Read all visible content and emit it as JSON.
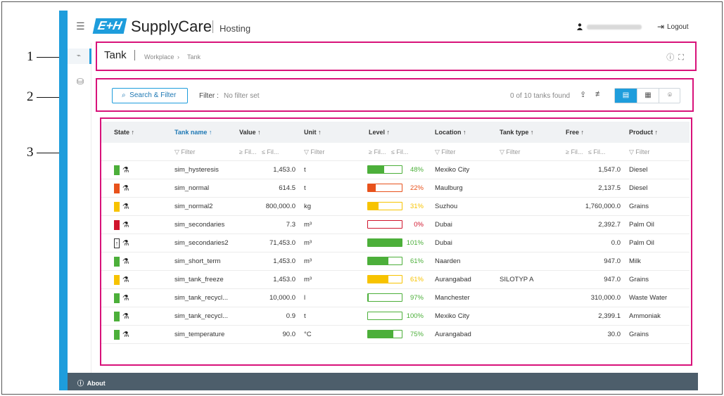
{
  "callouts": [
    "1",
    "2",
    "3"
  ],
  "app": {
    "brand_logo": "E+H",
    "brand_name": "SupplyCare",
    "brand_sub": "Hosting",
    "logout_label": "Logout",
    "about_label": "About"
  },
  "header": {
    "title": "Tank",
    "breadcrumb": [
      "Workplace",
      "Tank"
    ]
  },
  "toolbar": {
    "search_label": "Search & Filter",
    "filter_label": "Filter :",
    "filter_value": "No filter set",
    "tanks_found": "0 of 10 tanks found"
  },
  "table": {
    "columns": [
      "State",
      "Tank name",
      "Value",
      "Unit",
      "Level",
      "Location",
      "Tank type",
      "Free",
      "Product"
    ],
    "sorted_column": "Tank name",
    "filter_placeholder": "Filter",
    "range_min": "≥ Fil...",
    "range_max": "≤ Fil...",
    "rows": [
      {
        "state_color": "#4caf3a",
        "name": "sim_hysteresis",
        "value": "1,453.0",
        "unit": "t",
        "level": 48,
        "level_label": "48%",
        "level_color": "#4caf3a",
        "location": "Mexiko City",
        "tank_type": "",
        "free": "1,547.0",
        "product": "Diesel"
      },
      {
        "state_color": "#e8521c",
        "name": "sim_normal",
        "value": "614.5",
        "unit": "t",
        "level": 22,
        "level_label": "22%",
        "level_color": "#e8521c",
        "location": "Maulburg",
        "tank_type": "",
        "free": "2,137.5",
        "product": "Diesel"
      },
      {
        "state_color": "#f7c300",
        "name": "sim_normal2",
        "value": "800,000.0",
        "unit": "kg",
        "level": 31,
        "level_label": "31%",
        "level_color": "#f7c300",
        "location": "Suzhou",
        "tank_type": "",
        "free": "1,760,000.0",
        "product": "Grains"
      },
      {
        "state_color": "#d0142c",
        "name": "sim_secondaries",
        "value": "7.3",
        "unit": "m³",
        "level": 0,
        "level_label": "0%",
        "level_color": "#d0142c",
        "location": "Dubai",
        "tank_type": "",
        "free": "2,392.7",
        "product": "Palm Oil"
      },
      {
        "state_color": "",
        "name": "sim_secondaries2",
        "value": "71,453.0",
        "unit": "m³",
        "level": 101,
        "level_label": "101%",
        "level_color": "#4caf3a",
        "location": "Dubai",
        "tank_type": "",
        "free": "0.0",
        "product": "Palm Oil"
      },
      {
        "state_color": "#4caf3a",
        "name": "sim_short_term",
        "value": "1,453.0",
        "unit": "m³",
        "level": 61,
        "level_label": "61%",
        "level_color": "#4caf3a",
        "location": "Naarden",
        "tank_type": "",
        "free": "947.0",
        "product": "Milk"
      },
      {
        "state_color": "#f7c300",
        "name": "sim_tank_freeze",
        "value": "1,453.0",
        "unit": "m³",
        "level": 61,
        "level_label": "61%",
        "level_color": "#f7c300",
        "location": "Aurangabad",
        "tank_type": "SILOTYP A",
        "free": "947.0",
        "product": "Grains"
      },
      {
        "state_color": "#4caf3a",
        "name": "sim_tank_recycl...",
        "value": "10,000.0",
        "unit": "l",
        "level": 3,
        "level_label": "97%",
        "level_color": "#4caf3a",
        "location": "Manchester",
        "tank_type": "",
        "free": "310,000.0",
        "product": "Waste Water"
      },
      {
        "state_color": "#4caf3a",
        "name": "sim_tank_recycl...",
        "value": "0.9",
        "unit": "t",
        "level": 0,
        "level_label": "100%",
        "level_color": "#4caf3a",
        "location": "Mexiko City",
        "tank_type": "",
        "free": "2,399.1",
        "product": "Ammoniak"
      },
      {
        "state_color": "#4caf3a",
        "name": "sim_temperature",
        "value": "90.0",
        "unit": "°C",
        "level": 75,
        "level_label": "75%",
        "level_color": "#4caf3a",
        "location": "Aurangabad",
        "tank_type": "",
        "free": "30.0",
        "product": "Grains"
      }
    ]
  },
  "colors": {
    "accent": "#1e9ddc",
    "callout_box": "#d8127a",
    "footer": "#4d5e6b"
  }
}
